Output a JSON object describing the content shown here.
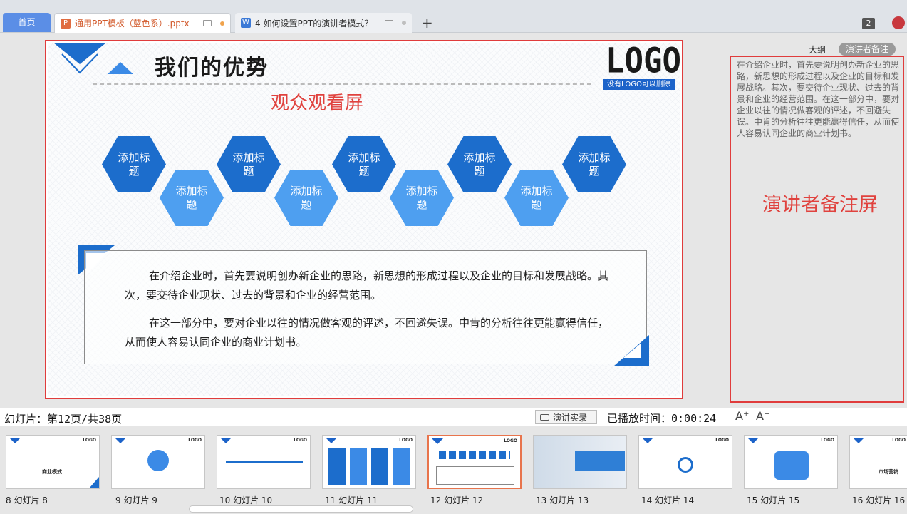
{
  "tabs": {
    "home": "首页",
    "documents": [
      {
        "icon": "ppt-file-icon",
        "label": "通用PPT模板（蓝色系）.pptx"
      },
      {
        "icon": "word-file-icon",
        "label": "4  如何设置PPT的演讲者模式？"
      }
    ],
    "new_tab": "+",
    "window_count": "2"
  },
  "slide": {
    "title": "我们的优势",
    "logo": "LOGO",
    "logo_note": "没有LOGO可以删除",
    "audience_label": "观众观看屏",
    "hexagons": [
      "添加标题",
      "添加标题",
      "添加标题",
      "添加标题",
      "添加标题",
      "添加标题",
      "添加标题",
      "添加标题",
      "添加标题"
    ],
    "paragraphs": [
      "在介绍企业时，首先要说明创办新企业的思路，新思想的形成过程以及企业的目标和发展战略。其次，要交待企业现状、过去的背景和企业的经营范围。",
      "在这一部分中，要对企业以往的情况做客观的评述，不回避失误。中肯的分析往往更能赢得信任，从而使人容易认同企业的商业计划书。"
    ]
  },
  "side_panel": {
    "tab_outline": "大纲",
    "tab_notes": "演讲者备注",
    "notes_text": "在介绍企业时，首先要说明创办新企业的思路，新思想的形成过程以及企业的目标和发展战略。其次，要交待企业现状、过去的背景和企业的经营范围。在这一部分中，要对企业以往的情况做客观的评述，不回避失误。中肯的分析往往更能赢得信任，从而使人容易认同企业的商业计划书。",
    "speaker_label": "演讲者备注屏"
  },
  "status": {
    "slide_counter": "幻灯片：第12页/共38页",
    "record_button": "演讲实录",
    "play_time": "已播放时间：0:00:24",
    "font_increase": "A⁺",
    "font_decrease": "A⁻"
  },
  "thumbnails": [
    {
      "caption": "8  幻灯片 8",
      "text": "商业模式"
    },
    {
      "caption": "9  幻灯片 9",
      "text": ""
    },
    {
      "caption": "10  幻灯片 10",
      "text": ""
    },
    {
      "caption": "11  幻灯片 11",
      "text": ""
    },
    {
      "caption": "12  幻灯片 12",
      "text": "",
      "active": true
    },
    {
      "caption": "13  幻灯片 13",
      "text": ""
    },
    {
      "caption": "14  幻灯片 14",
      "text": ""
    },
    {
      "caption": "15  幻灯片 15",
      "text": ""
    },
    {
      "caption": "16  幻灯片 16",
      "text": "市场营销"
    }
  ],
  "colors": {
    "accent_blue": "#1c6dcc",
    "light_blue": "#4e9ff0",
    "annotation_red": "#e03c3c"
  }
}
